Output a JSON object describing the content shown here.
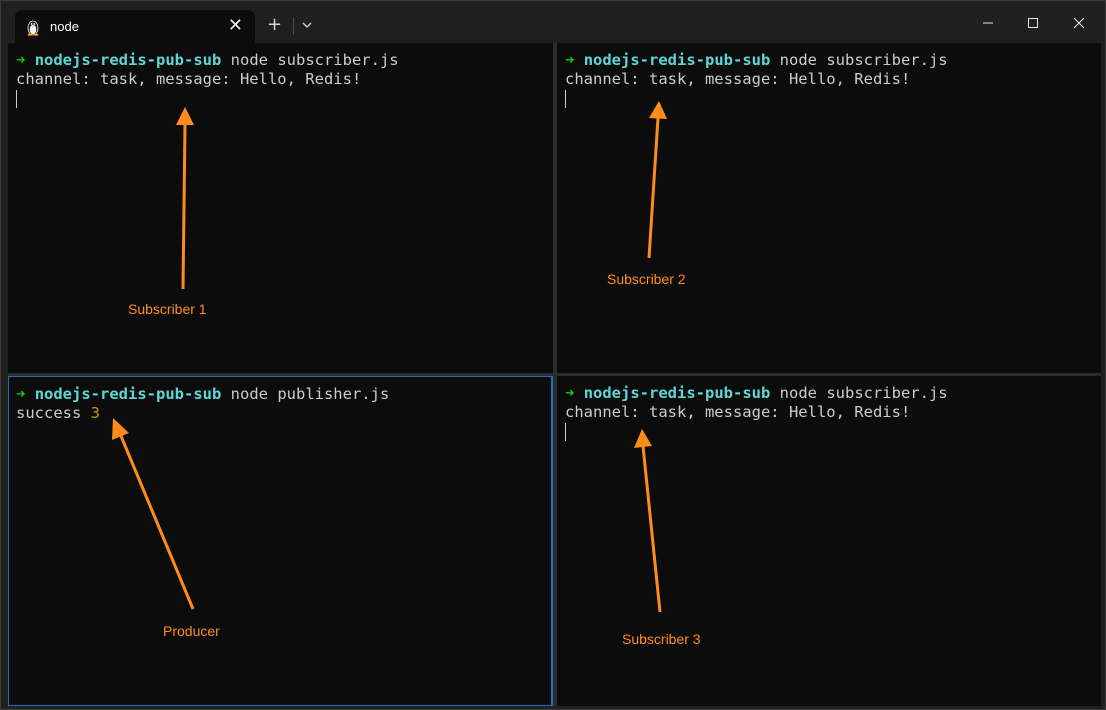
{
  "tab": {
    "title": "node",
    "icon": "linux-penguin-icon"
  },
  "colors": {
    "prompt_arrow": "#16c60c",
    "directory": "#61d6d6",
    "number": "#c19c00",
    "annotation": "#ff8c1a",
    "active_border": "#1f6fbf"
  },
  "panes": {
    "top_left": {
      "arrow": "➜",
      "dir": "nodejs-redis-pub-sub",
      "command": " node subscriber.js",
      "output": "channel: task, message: Hello, Redis!"
    },
    "top_right": {
      "arrow": "➜",
      "dir": "nodejs-redis-pub-sub",
      "command": " node subscriber.js",
      "output": "channel: task, message: Hello, Redis!"
    },
    "bottom_left": {
      "arrow": "➜",
      "dir": "nodejs-redis-pub-sub",
      "command": " node publisher.js",
      "output_text": "success ",
      "output_num": "3"
    },
    "bottom_right": {
      "arrow": "➜",
      "dir": "nodejs-redis-pub-sub",
      "command": " node subscriber.js",
      "output": "channel: task, message: Hello, Redis!"
    }
  },
  "annotations": {
    "subscriber1": "Subscriber 1",
    "subscriber2": "Subscriber 2",
    "producer": "Producer",
    "subscriber3": "Subscriber 3"
  }
}
